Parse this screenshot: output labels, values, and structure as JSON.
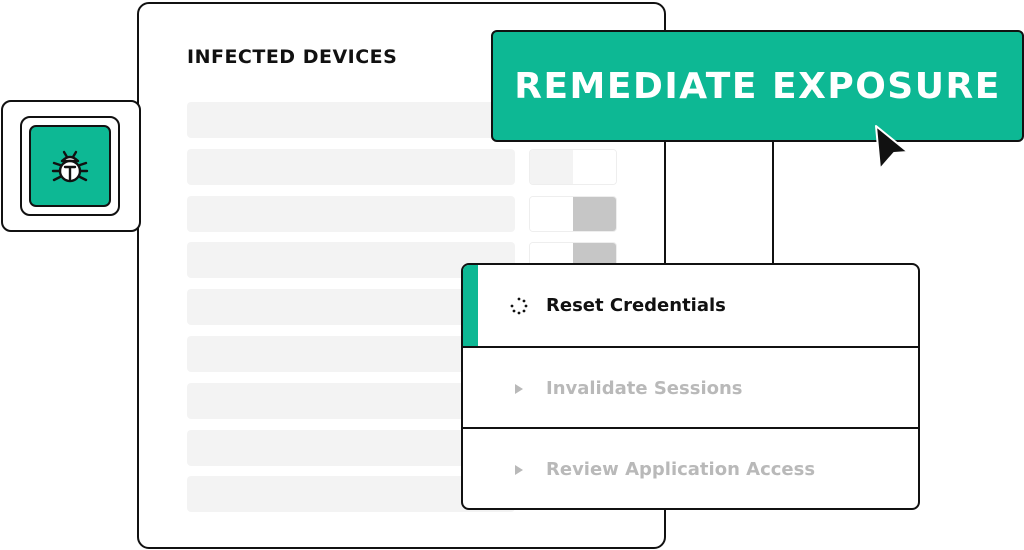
{
  "devices_panel": {
    "title": "INFECTED DEVICES",
    "rows": [
      {
        "toggle": null
      },
      {
        "toggle": "left"
      },
      {
        "toggle": "right"
      },
      {
        "toggle": "right"
      },
      {
        "toggle": null
      },
      {
        "toggle": null
      },
      {
        "toggle": null
      },
      {
        "toggle": null
      },
      {
        "toggle": null
      }
    ]
  },
  "badge": {
    "icon": "bug-icon"
  },
  "action": {
    "label": "REMEDIATE EXPOSURE"
  },
  "steps": [
    {
      "label": "Reset Credentials",
      "state": "active",
      "icon": "spinner-icon"
    },
    {
      "label": "Invalidate Sessions",
      "state": "inactive",
      "icon": "play-arrow-icon"
    },
    {
      "label": "Review Application Access",
      "state": "inactive",
      "icon": "play-arrow-icon"
    }
  ],
  "colors": {
    "accent": "#0db894",
    "outline": "#111111",
    "placeholder": "#f3f3f3",
    "toggle_on": "#c6c6c6",
    "muted_text": "#b9b9b9"
  }
}
